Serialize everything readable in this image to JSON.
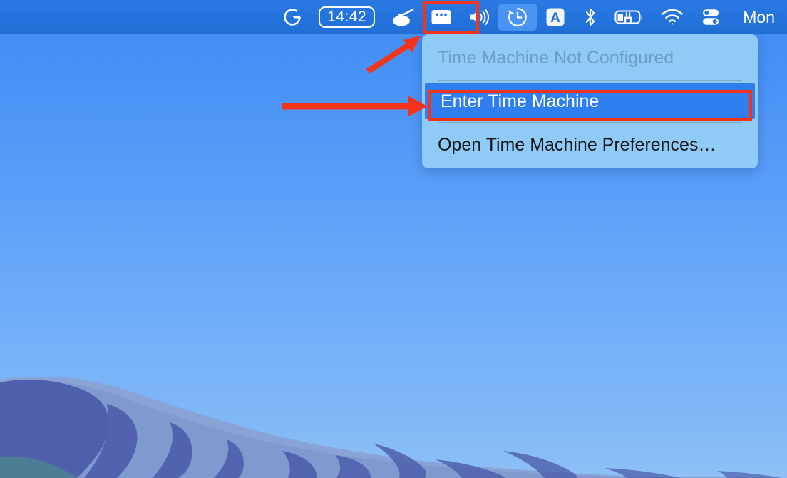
{
  "menubar": {
    "background_color": "#2473dd",
    "items": [
      {
        "id": "grammarly",
        "icon": "grammarly-g-icon",
        "label": ""
      },
      {
        "id": "clock",
        "icon": "clock-time-display",
        "label": "14:42"
      },
      {
        "id": "turret",
        "icon": "turret-icon",
        "label": ""
      },
      {
        "id": "window-dots",
        "icon": "window-dots-icon",
        "label": ""
      },
      {
        "id": "volume",
        "icon": "volume-speaker-icon",
        "label": ""
      },
      {
        "id": "time-machine",
        "icon": "time-machine-clock-icon",
        "label": "",
        "selected": true
      },
      {
        "id": "input-source",
        "icon": "keyboard-input-a-icon",
        "label": ""
      },
      {
        "id": "bluetooth",
        "icon": "bluetooth-icon",
        "label": ""
      },
      {
        "id": "battery",
        "icon": "battery-charging-icon",
        "label": ""
      },
      {
        "id": "wifi",
        "icon": "wifi-icon",
        "label": ""
      },
      {
        "id": "control-center",
        "icon": "control-center-toggles-icon",
        "label": ""
      },
      {
        "id": "date",
        "icon": "",
        "label": "Mon"
      }
    ],
    "clock_value": "14:42",
    "date_value": "Mon"
  },
  "menu": {
    "background_color": "#8fcbf6",
    "highlight_color": "#2e7ef0",
    "items": [
      {
        "label": "Time Machine Not Configured",
        "state": "disabled"
      },
      {
        "label": "Enter Time Machine",
        "state": "highlighted"
      },
      {
        "label": "Open Time Machine Preferences…",
        "state": "normal"
      }
    ]
  },
  "annotations": {
    "highlight_color": "#f4341a",
    "boxes": [
      {
        "target": "time-machine-menubar-icon"
      },
      {
        "target": "enter-time-machine-menu-item"
      }
    ],
    "arrows": [
      {
        "target": "time-machine-menubar-icon",
        "direction": "up-right"
      },
      {
        "target": "enter-time-machine-menu-item",
        "direction": "right"
      }
    ]
  }
}
